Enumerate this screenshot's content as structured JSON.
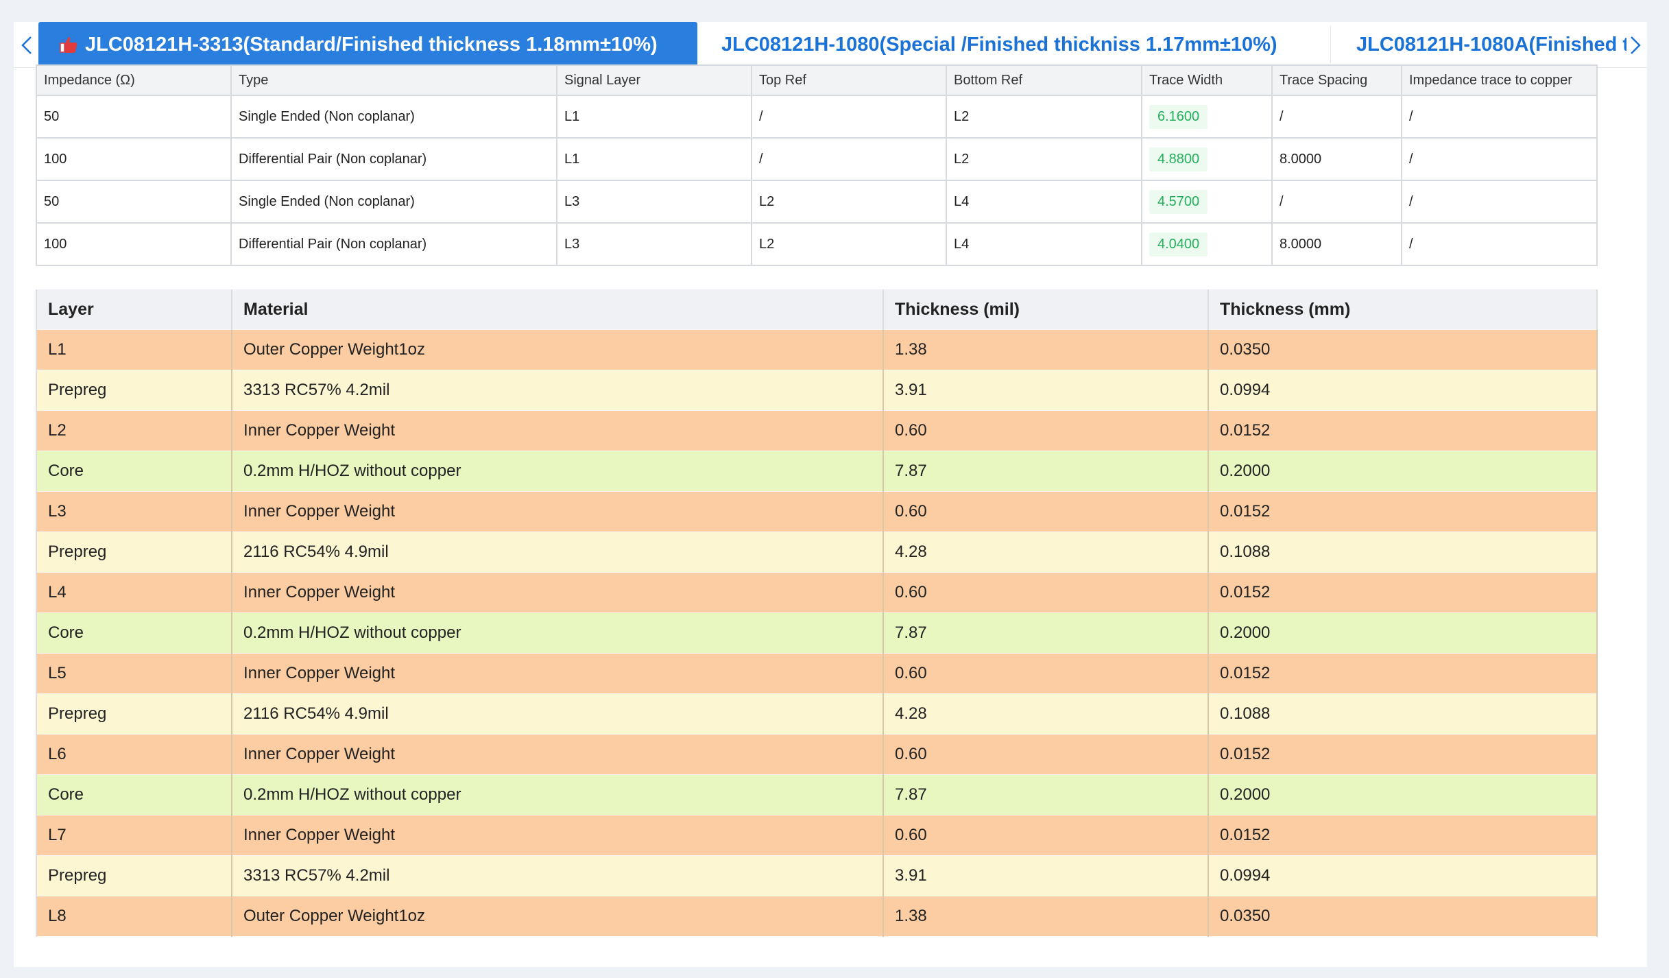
{
  "tabs": [
    {
      "label": "JLC08121H-3313(Standard/Finished thickness 1.18mm±10%)",
      "active": true,
      "icon": "thumbs-up-icon"
    },
    {
      "label": "JLC08121H-1080(Special /Finished thickniss 1.17mm±10%)",
      "active": false
    },
    {
      "label": "JLC08121H-1080A(Finished t",
      "active": false
    }
  ],
  "nav": {
    "prev_icon": "chevron-left-icon",
    "next_icon": "chevron-right-icon"
  },
  "impedance": {
    "headers": [
      "Impedance (Ω)",
      "Type",
      "Signal Layer",
      "Top Ref",
      "Bottom Ref",
      "Trace Width",
      "Trace Spacing",
      "Impedance trace to copper"
    ],
    "rows": [
      [
        "50",
        "Single Ended (Non coplanar)",
        "L1",
        "/",
        "L2",
        "6.1600",
        "/",
        "/"
      ],
      [
        "100",
        "Differential Pair (Non coplanar)",
        "L1",
        "/",
        "L2",
        "4.8800",
        "8.0000",
        "/"
      ],
      [
        "50",
        "Single Ended (Non coplanar)",
        "L3",
        "L2",
        "L4",
        "4.5700",
        "/",
        "/"
      ],
      [
        "100",
        "Differential Pair (Non coplanar)",
        "L3",
        "L2",
        "L4",
        "4.0400",
        "8.0000",
        "/"
      ]
    ]
  },
  "stackup": {
    "headers": [
      "Layer",
      "Material",
      "Thickness (mil)",
      "Thickness (mm)"
    ],
    "colors": {
      "copper": "#fccda2",
      "prepreg": "#fdf6d3",
      "core": "#e8f6c0",
      "trace_width": "#22b15c",
      "tab_active": "#2a7fde"
    },
    "rows": [
      {
        "kind": "copper",
        "cells": [
          "L1",
          "Outer Copper Weight1oz",
          "1.38",
          "0.0350"
        ]
      },
      {
        "kind": "prepreg",
        "cells": [
          "Prepreg",
          "3313 RC57% 4.2mil",
          "3.91",
          "0.0994"
        ]
      },
      {
        "kind": "copper",
        "cells": [
          "L2",
          "Inner Copper Weight",
          "0.60",
          "0.0152"
        ]
      },
      {
        "kind": "core",
        "cells": [
          "Core",
          "0.2mm H/HOZ without copper",
          "7.87",
          "0.2000"
        ]
      },
      {
        "kind": "copper",
        "cells": [
          "L3",
          "Inner Copper Weight",
          "0.60",
          "0.0152"
        ]
      },
      {
        "kind": "prepreg",
        "cells": [
          "Prepreg",
          "2116 RC54% 4.9mil",
          "4.28",
          "0.1088"
        ]
      },
      {
        "kind": "copper",
        "cells": [
          "L4",
          "Inner Copper Weight",
          "0.60",
          "0.0152"
        ]
      },
      {
        "kind": "core",
        "cells": [
          "Core",
          "0.2mm H/HOZ without copper",
          "7.87",
          "0.2000"
        ]
      },
      {
        "kind": "copper",
        "cells": [
          "L5",
          "Inner Copper Weight",
          "0.60",
          "0.0152"
        ]
      },
      {
        "kind": "prepreg",
        "cells": [
          "Prepreg",
          "2116 RC54% 4.9mil",
          "4.28",
          "0.1088"
        ]
      },
      {
        "kind": "copper",
        "cells": [
          "L6",
          "Inner Copper Weight",
          "0.60",
          "0.0152"
        ]
      },
      {
        "kind": "core",
        "cells": [
          "Core",
          "0.2mm H/HOZ without copper",
          "7.87",
          "0.2000"
        ]
      },
      {
        "kind": "copper",
        "cells": [
          "L7",
          "Inner Copper Weight",
          "0.60",
          "0.0152"
        ]
      },
      {
        "kind": "prepreg",
        "cells": [
          "Prepreg",
          "3313 RC57% 4.2mil",
          "3.91",
          "0.0994"
        ]
      },
      {
        "kind": "copper",
        "cells": [
          "L8",
          "Outer Copper Weight1oz",
          "1.38",
          "0.0350"
        ]
      }
    ]
  }
}
